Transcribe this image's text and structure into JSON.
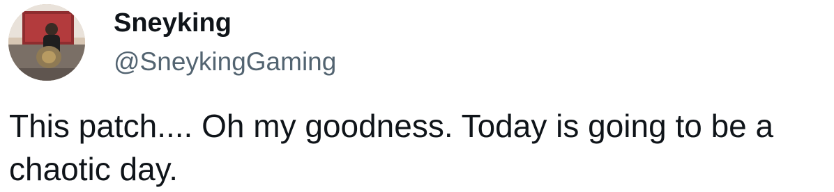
{
  "author": {
    "display_name": "Sneyking",
    "handle": "@SneykingGaming",
    "avatar_icon": "profile-photo"
  },
  "tweet": {
    "text": "This patch.... Oh my goodness. Today is going to be a chaotic day."
  },
  "colors": {
    "background": "#ffffff",
    "name_text": "#0f1419",
    "handle_text": "#536471",
    "body_text": "#0f1419"
  }
}
